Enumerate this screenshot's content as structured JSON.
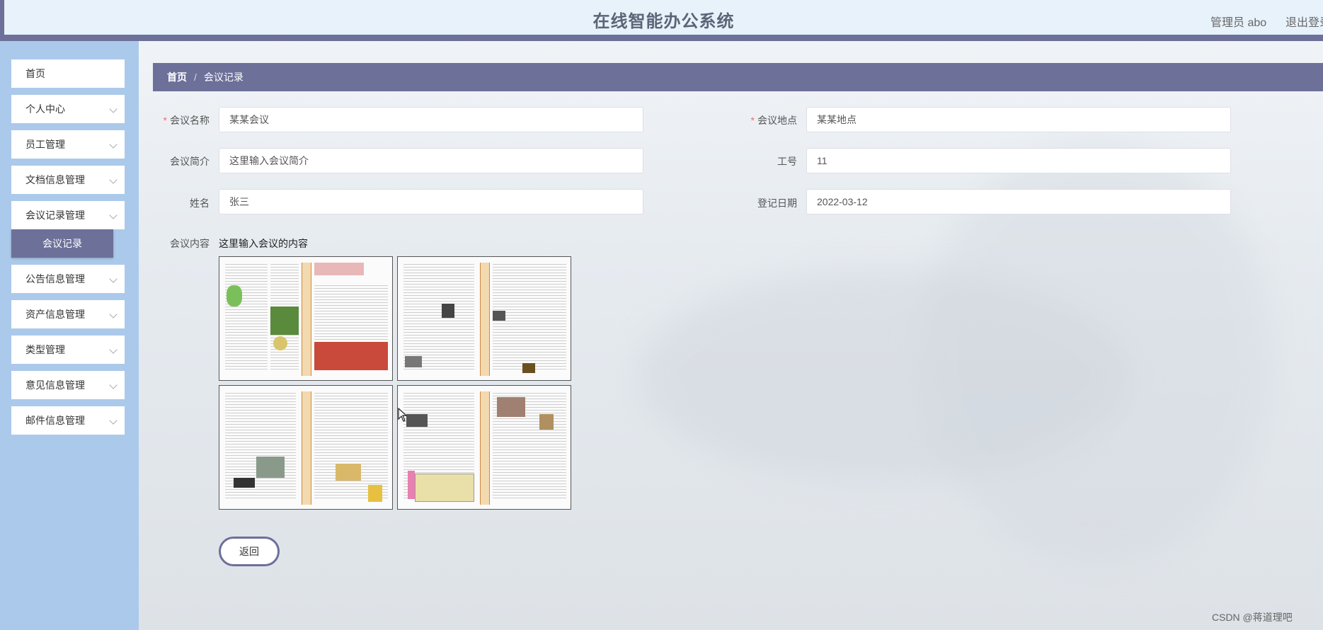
{
  "header": {
    "title": "在线智能办公系统",
    "user": "管理员 abo",
    "logout": "退出登录"
  },
  "sidebar": {
    "items": [
      {
        "label": "首页",
        "has_children": false
      },
      {
        "label": "个人中心",
        "has_children": true
      },
      {
        "label": "员工管理",
        "has_children": true
      },
      {
        "label": "文档信息管理",
        "has_children": true
      },
      {
        "label": "会议记录管理",
        "has_children": true
      },
      {
        "label": "公告信息管理",
        "has_children": true
      },
      {
        "label": "资产信息管理",
        "has_children": true
      },
      {
        "label": "类型管理",
        "has_children": true
      },
      {
        "label": "意见信息管理",
        "has_children": true
      },
      {
        "label": "邮件信息管理",
        "has_children": true
      }
    ],
    "active_submenu": "会议记录"
  },
  "breadcrumb": {
    "home": "首页",
    "separator": "/",
    "current": "会议记录"
  },
  "form": {
    "meeting_name": {
      "label": "会议名称",
      "required": true,
      "value": "某某会议"
    },
    "meeting_location": {
      "label": "会议地点",
      "required": true,
      "value": "某某地点"
    },
    "meeting_summary": {
      "label": "会议简介",
      "value": "这里输入会议简介"
    },
    "employee_id": {
      "label": "工号",
      "value": "11"
    },
    "name": {
      "label": "姓名",
      "value": "张三"
    },
    "register_date": {
      "label": "登记日期",
      "value": "2022-03-12"
    },
    "content": {
      "label": "会议内容",
      "text": "这里输入会议的内容"
    },
    "back_button": "返回"
  },
  "watermark": "CSDN @蒋道理吧",
  "colors": {
    "accent": "#6d7099",
    "sidebar_bg": "#abc9ea",
    "header_bg": "#e8f2fb",
    "required": "#f56c6c"
  }
}
